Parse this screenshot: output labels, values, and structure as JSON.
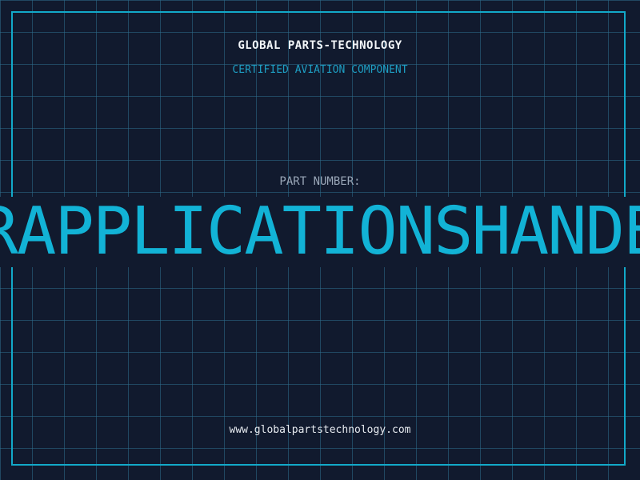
{
  "header": {
    "company": "GLOBAL PARTS-TECHNOLOGY",
    "subtitle": "CERTIFIED AVIATION COMPONENT"
  },
  "part": {
    "label": "PART NUMBER:",
    "number": "ARAPPLICATIONSHANDEB"
  },
  "footer": {
    "website": "www.globalpartstechnology.com"
  },
  "colors": {
    "background": "#111a2e",
    "grid": "#2e6e8c",
    "accent": "#12b3d6",
    "frame": "#12a9c9"
  }
}
